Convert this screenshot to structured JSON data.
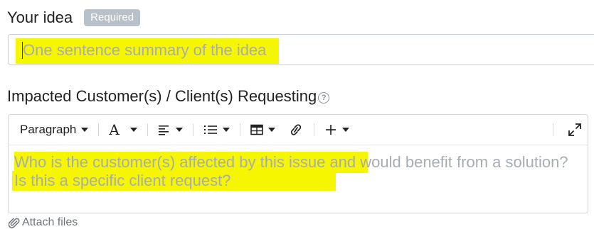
{
  "idea": {
    "label": "Your idea",
    "badge": "Required",
    "placeholder": "One sentence summary of the idea"
  },
  "impacted": {
    "label": "Impacted Customer(s) / Client(s) Requesting",
    "help_icon": "?",
    "placeholder": "Who is the customer(s) affected by this issue and would benefit from a solution? Is this a specific client request?"
  },
  "toolbar": {
    "paragraph_label": "Paragraph",
    "font_label": "A",
    "icons": [
      "align-icon",
      "list-icon",
      "table-icon",
      "link-icon",
      "plus-icon",
      "expand-icon"
    ]
  },
  "attach": {
    "label": "Attach files"
  },
  "colors": {
    "highlight": "#f6f600",
    "placeholder": "#a7adb3",
    "badge": "#b8c0c9"
  }
}
